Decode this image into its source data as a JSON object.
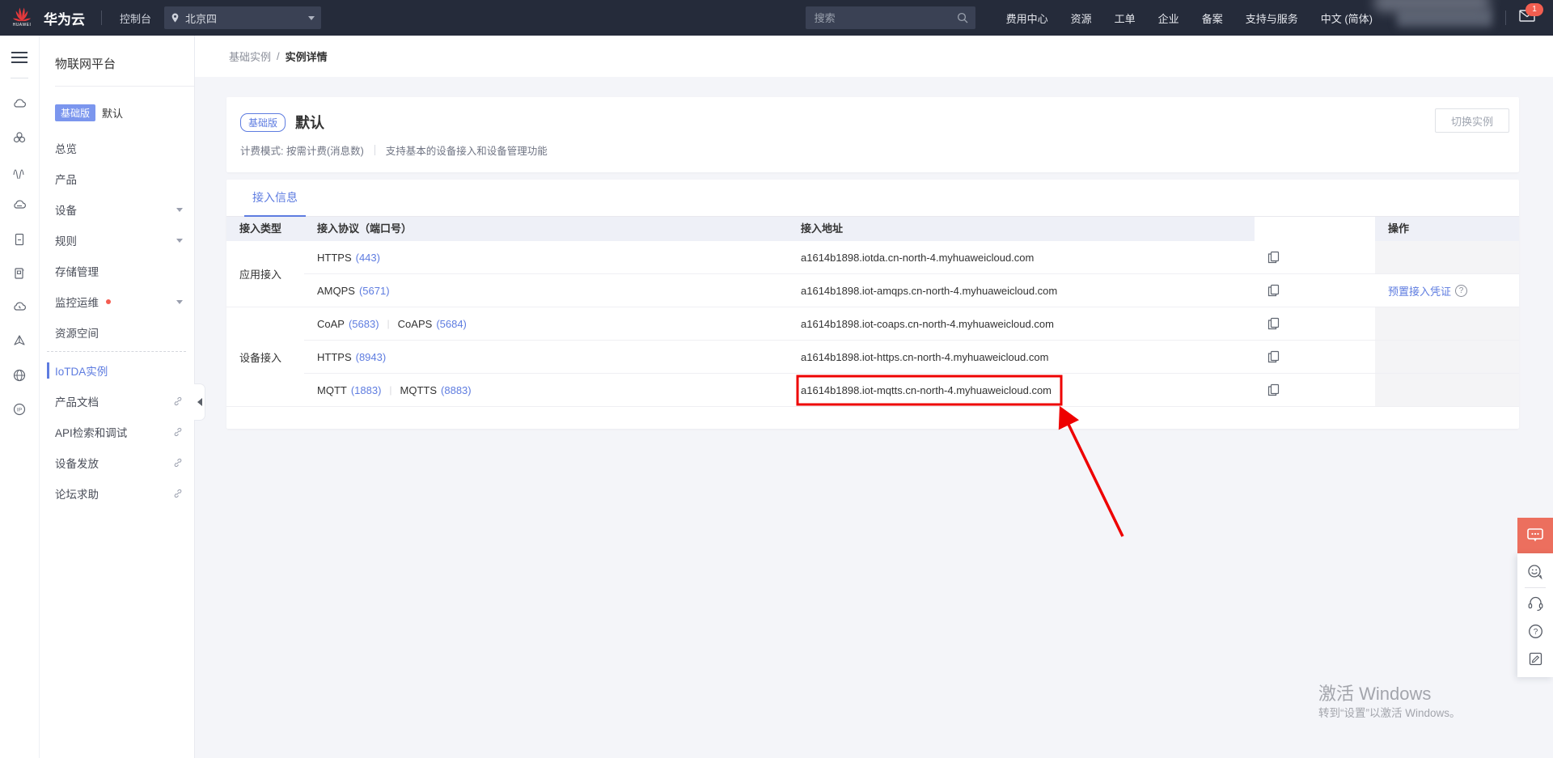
{
  "topbar": {
    "logo_text": "HUAWEI",
    "brand": "华为云",
    "console_label": "控制台",
    "region": "北京四",
    "search_placeholder": "搜索",
    "links": [
      "费用中心",
      "资源",
      "工单",
      "企业",
      "备案",
      "支持与服务",
      "中文 (简体)"
    ],
    "mail_badge_count": "1"
  },
  "rail_icons": [
    "overview-cloud",
    "tenant",
    "waves",
    "cloud-server",
    "document",
    "notebook",
    "cloud-monitor",
    "send-pyramid",
    "globe",
    "ip"
  ],
  "sidebar": {
    "title": "物联网平台",
    "edition_badge": "基础版",
    "edition_name": "默认",
    "items": [
      {
        "id": "overview",
        "label": "总览"
      },
      {
        "id": "products",
        "label": "产品"
      },
      {
        "id": "devices",
        "label": "设备",
        "caret": true
      },
      {
        "id": "rules",
        "label": "规则",
        "caret": true
      },
      {
        "id": "storage",
        "label": "存储管理"
      },
      {
        "id": "monitor-om",
        "label": "监控运维",
        "caret": true,
        "dot": true
      },
      {
        "id": "resource-spaces",
        "label": "资源空间"
      },
      {
        "id": "iotda-instances",
        "label": "IoTDA实例",
        "active": true,
        "divider_before": true
      },
      {
        "id": "product-docs",
        "label": "产品文档",
        "external": true
      },
      {
        "id": "api-explorer",
        "label": "API检索和调试",
        "external": true
      },
      {
        "id": "device-provisioning",
        "label": "设备发放",
        "external": true
      },
      {
        "id": "forum-help",
        "label": "论坛求助",
        "external": true
      }
    ]
  },
  "breadcrumb": {
    "parent": "基础实例",
    "separator": "/",
    "current": "实例详情"
  },
  "instance_card": {
    "edition_badge": "基础版",
    "name": "默认",
    "billing": "计费模式: 按需计费(消息数)",
    "description": "支持基本的设备接入和设备管理功能",
    "switch_button": "切换实例"
  },
  "access_card": {
    "tab_label": "接入信息",
    "table": {
      "headers": {
        "type": "接入类型",
        "protocol": "接入协议（端口号）",
        "address": "接入地址",
        "action": "操作"
      },
      "groups": [
        {
          "type": "应用接入",
          "rows": [
            {
              "protocols": [
                {
                  "name": "HTTPS",
                  "port": "(443)"
                }
              ],
              "address": "a1614b1898.iotda.cn-north-4.myhuaweicloud.com",
              "action": ""
            },
            {
              "protocols": [
                {
                  "name": "AMQPS",
                  "port": "(5671)"
                }
              ],
              "address": "a1614b1898.iot-amqps.cn-north-4.myhuaweicloud.com",
              "action": "预置接入凭证"
            }
          ]
        },
        {
          "type": "设备接入",
          "rows": [
            {
              "protocols": [
                {
                  "name": "CoAP",
                  "port": "(5683)"
                },
                {
                  "name": "CoAPS",
                  "port": "(5684)"
                }
              ],
              "address": "a1614b1898.iot-coaps.cn-north-4.myhuaweicloud.com",
              "action": ""
            },
            {
              "protocols": [
                {
                  "name": "HTTPS",
                  "port": "(8943)"
                }
              ],
              "address": "a1614b1898.iot-https.cn-north-4.myhuaweicloud.com",
              "action": ""
            },
            {
              "protocols": [
                {
                  "name": "MQTT",
                  "port": "(1883)"
                },
                {
                  "name": "MQTTS",
                  "port": "(8883)"
                }
              ],
              "address": "a1614b1898.iot-mqtts.cn-north-4.myhuaweicloud.com",
              "action": "",
              "highlighted": true
            }
          ]
        }
      ]
    }
  },
  "watermark": {
    "line1": "激活 Windows",
    "line2": "转到“设置”以激活 Windows。"
  },
  "colors": {
    "topbar_bg": "#252b3a",
    "accent_blue": "#5e7ce0",
    "sidebar_badge_blue": "#7b96ee",
    "notification_red": "#f25e50",
    "annotation_red": "#ee0000",
    "table_header_bg": "#eef0f7",
    "disabled_action_bg": "#f4f4f6",
    "page_bg": "#f4f5f9"
  }
}
